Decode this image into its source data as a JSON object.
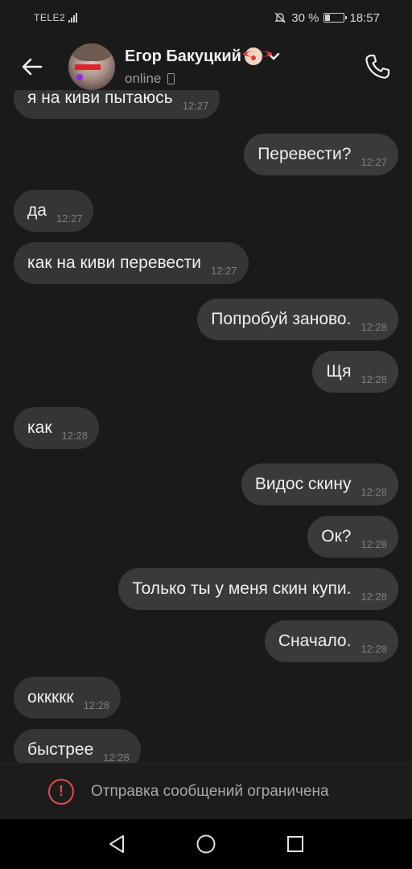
{
  "status_bar": {
    "carrier": "TELE2",
    "battery_percent": "30 %",
    "battery_level": 0.3,
    "time": "18:57"
  },
  "header": {
    "name": "Егор Бакуцкий",
    "status": "online",
    "avatar_text": "supreme"
  },
  "messages": [
    {
      "text": "я на киви пытаюсь",
      "time": "12:27",
      "direction": "in"
    },
    {
      "text": "Перевести?",
      "time": "12:27",
      "direction": "out"
    },
    {
      "text": "да",
      "time": "12:27",
      "direction": "in"
    },
    {
      "text": "как на киви перевести",
      "time": "12:27",
      "direction": "in"
    },
    {
      "text": "Попробуй заново.",
      "time": "12:28",
      "direction": "out"
    },
    {
      "text": "Щя",
      "time": "12:28",
      "direction": "out"
    },
    {
      "text": "как",
      "time": "12:28",
      "direction": "in"
    },
    {
      "text": "Видос скину",
      "time": "12:28",
      "direction": "out"
    },
    {
      "text": "Ок?",
      "time": "12:28",
      "direction": "out"
    },
    {
      "text": "Только ты у меня скин купи.",
      "time": "12:28",
      "direction": "out"
    },
    {
      "text": "Сначало.",
      "time": "12:28",
      "direction": "out"
    },
    {
      "text": "оккккк",
      "time": "12:28",
      "direction": "in"
    },
    {
      "text": "быстрее",
      "time": "12:28",
      "direction": "in"
    }
  ],
  "restriction": {
    "text": "Отправка сообщений ограничена"
  },
  "colors": {
    "background": "#1a1a1a",
    "bubble": "#353535",
    "warning": "#e84a4a"
  }
}
